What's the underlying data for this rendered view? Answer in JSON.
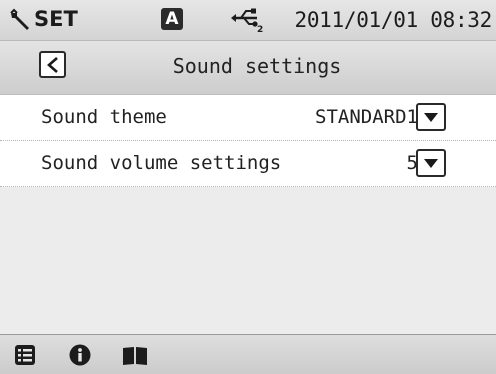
{
  "statusbar": {
    "mode_icon": "wrench-icon",
    "mode_label": "SET",
    "badge_label": "A",
    "usb_icon": "usb-icon",
    "datetime": "2011/01/01 08:32"
  },
  "header": {
    "back_icon": "chevron-left-icon",
    "title": "Sound settings"
  },
  "settings": [
    {
      "label": "Sound theme",
      "value": "STANDARD1",
      "control": "dropdown"
    },
    {
      "label": "Sound volume settings",
      "value": "5",
      "control": "dropdown"
    }
  ],
  "toolbar": {
    "icons": [
      "list-icon",
      "info-icon",
      "manual-book-icon"
    ]
  },
  "colors": {
    "bar_background": "#d4d4d4",
    "list_background": "#ffffff",
    "empty_background": "#ececec",
    "badge_background": "#2b2b2b"
  }
}
